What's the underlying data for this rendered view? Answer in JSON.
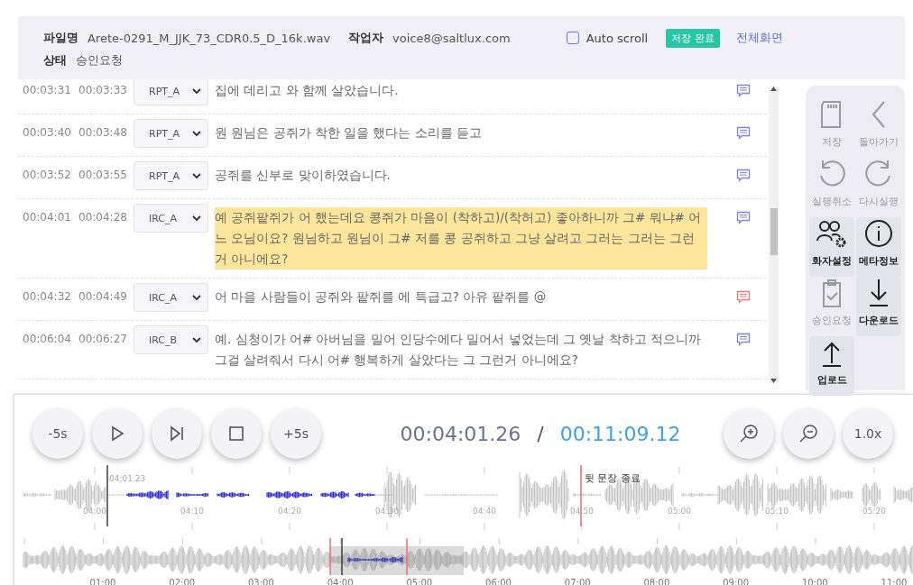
{
  "header": {
    "file_label": "파일명",
    "file_name": "Arete-0291_M_JJK_73_CDR0.5_D_16k.wav",
    "worker_label": "작업자",
    "worker": "voice8@saltlux.com",
    "auto_scroll": {
      "label": "Auto scroll",
      "checked": false
    },
    "save_badge": "저장 완료",
    "fullscreen_link": "전체화면",
    "status_label": "상태",
    "status": "승인요청"
  },
  "rows": [
    {
      "start": "00:03:31",
      "end": "00:03:33",
      "speaker": "RPT_A",
      "text": "집에 데리고 와 함께 살았습니다.",
      "selected": false,
      "color": "#7b83e8"
    },
    {
      "start": "00:03:40",
      "end": "00:03:48",
      "speaker": "RPT_A",
      "text": "원 원님은 공쥐가 착한 일을 했다는 소리를 듣고",
      "selected": false,
      "color": "#7b83e8"
    },
    {
      "start": "00:03:52",
      "end": "00:03:55",
      "speaker": "RPT_A",
      "text": "공쥐를 신부로 맞이하였습니다.",
      "selected": false,
      "color": "#7b83e8"
    },
    {
      "start": "00:04:01",
      "end": "00:04:28",
      "speaker": "IRC_A",
      "text": "예 공쥐팥쥐가 어 했는데요 콩쥐가 마음이 (착하고)/(착허고) 좋아하니까 그# 뭐냐# 어느 오님이요? 원님하고 원님이 그# 저를 콩 공쥐하고 그냥 살려고 그러는 그러는 그런 거 아니에요?",
      "selected": true,
      "color": "#7b83e8"
    },
    {
      "start": "00:04:32",
      "end": "00:04:49",
      "speaker": "IRC_A",
      "text": "어 마을 사람들이 공쥐와 팥쥐를 에 특급고? 아유 팥쥐를 @",
      "selected": false,
      "color": "#f07b7b"
    },
    {
      "start": "00:06:04",
      "end": "00:06:27",
      "speaker": "IRC_B",
      "text": "예. 심청이가 어# 아버님을 밀어 인당수에다 밀어서 넣었는데 그 옛날 착하고 적으니까 그걸 살려줘서 다시 어# 행복하게 살았다는 그 그런거 아니에요?",
      "selected": false,
      "color": "#7b83e8"
    }
  ],
  "side_tools": [
    {
      "kind": "save",
      "label": "저장",
      "disabled": true
    },
    {
      "kind": "back",
      "label": "돌아가기",
      "disabled": true
    },
    {
      "kind": "undo",
      "label": "실행취소",
      "disabled": true
    },
    {
      "kind": "redo",
      "label": "다시실행",
      "disabled": true
    },
    {
      "kind": "speaker",
      "label": "화자설정",
      "disabled": false
    },
    {
      "kind": "info",
      "label": "메타정보",
      "disabled": false
    },
    {
      "kind": "approve",
      "label": "승인요청",
      "disabled": true
    },
    {
      "kind": "download",
      "label": "다운로드",
      "disabled": false
    },
    {
      "kind": "upload",
      "label": "업로드",
      "disabled": false
    }
  ],
  "player": {
    "left_buttons": [
      {
        "kind": "text",
        "label": "-5s"
      },
      {
        "kind": "play"
      },
      {
        "kind": "next"
      },
      {
        "kind": "stop"
      },
      {
        "kind": "text",
        "label": "+5s"
      }
    ],
    "current_time": "00:04:01.26",
    "separator": "/",
    "total_time": "00:11:09.12",
    "right_buttons": [
      {
        "kind": "zoom-in"
      },
      {
        "kind": "zoom-out"
      },
      {
        "kind": "text",
        "label": "1.0x"
      }
    ]
  },
  "zoom_wave": {
    "cursor_label": "04:01.23",
    "marker_label": "뒷 문장 종료",
    "ticks": [
      "04:00",
      "04:10",
      "04:20",
      "04:30",
      "04:40",
      "04:50",
      "05:00",
      "05:10",
      "05:20"
    ]
  },
  "overview": {
    "ticks": [
      "01:00",
      "02:00",
      "03:00",
      "04:00",
      "05:00",
      "06:00",
      "07:00",
      "08:00",
      "09:00",
      "10:00",
      "11:00"
    ]
  }
}
